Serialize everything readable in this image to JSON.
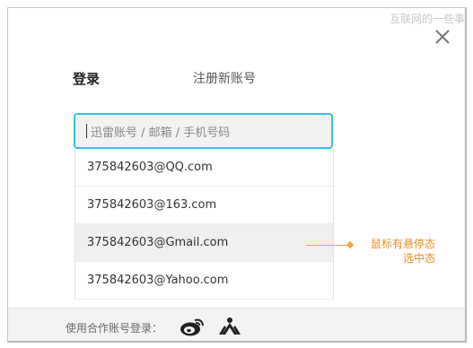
{
  "watermark": "互联网的一些事",
  "tabs": {
    "login": "登录",
    "register": "注册新账号"
  },
  "account_input": {
    "placeholder": "迅雷账号 / 邮箱 / 手机号码"
  },
  "suggestions": [
    "375842603@QQ.com",
    "375842603@163.com",
    "375842603@Gmail.com",
    "375842603@Yahoo.com"
  ],
  "hover_index": 2,
  "annotation": {
    "line1": "鼠标有悬停态",
    "line2": "选中态"
  },
  "footer": {
    "label": "使用合作账号登录："
  },
  "colors": {
    "accent": "#31c3ec",
    "annotation": "#f7a23b"
  },
  "icons": [
    "close-icon",
    "weibo-icon",
    "renren-icon"
  ]
}
